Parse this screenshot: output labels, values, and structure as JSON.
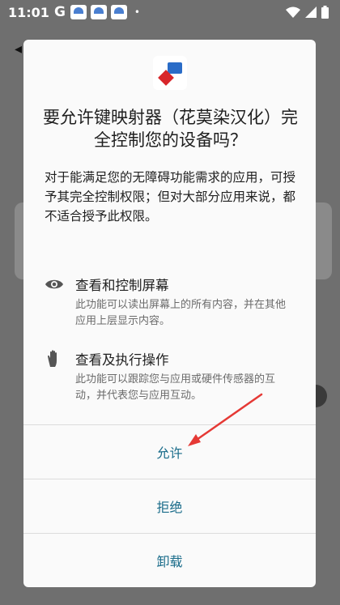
{
  "status_bar": {
    "time": "11:01",
    "g_label": "G",
    "dot": "•",
    "icons": [
      "notification-app-icon",
      "notification-app-icon",
      "notification-app-icon"
    ],
    "right_icons": [
      "wifi-icon",
      "signal-icon",
      "battery-icon"
    ]
  },
  "dialog": {
    "app_icon": "key-mapper-app-icon",
    "title": "要允许键映射器（花莫染汉化）完全控制您的设备吗？",
    "description": "对于能满足您的无障碍功能需求的应用，可授予其完全控制权限；但对大部分应用来说，都不适合授予此权限。",
    "permissions": [
      {
        "icon": "eye-icon",
        "title": "查看和控制屏幕",
        "description": "此功能可以读出屏幕上的所有内容，并在其他应用上层显示内容。"
      },
      {
        "icon": "hand-icon",
        "title": "查看及执行操作",
        "description": "此功能可以跟踪您与应用或硬件传感器的互动，并代表您与应用互动。"
      }
    ],
    "actions": {
      "allow": "允许",
      "deny": "拒绝",
      "uninstall": "卸载"
    },
    "colors": {
      "accent": "#1a6c8a",
      "annotation_arrow": "#e53935"
    }
  }
}
